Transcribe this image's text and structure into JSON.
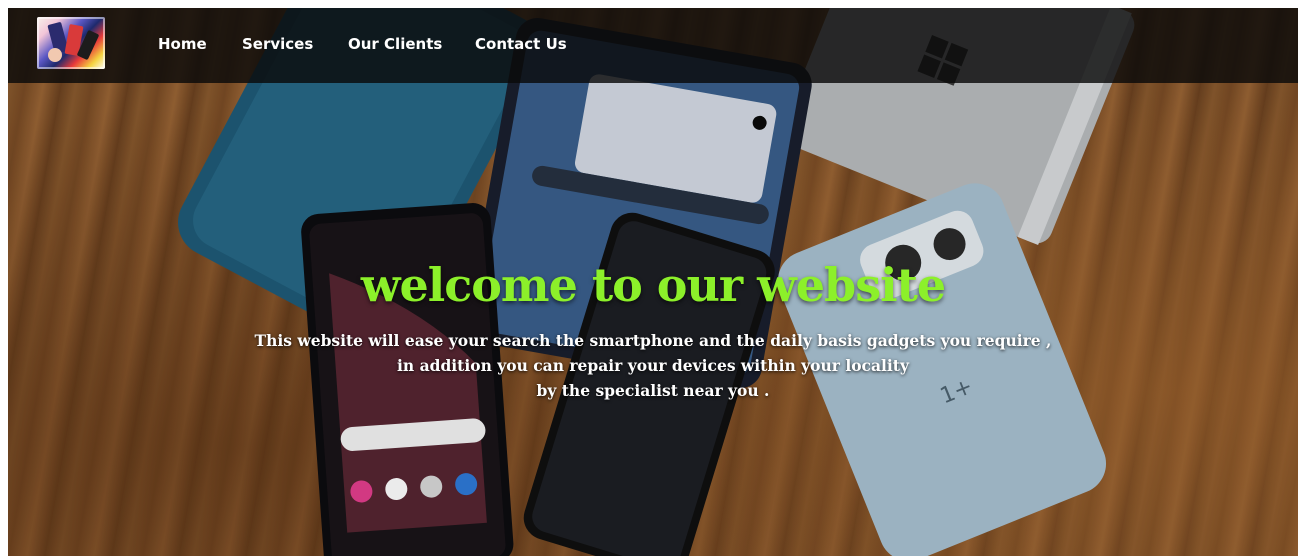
{
  "nav": {
    "logo_icon": "colorful-phones-logo-icon",
    "items": [
      {
        "label": "Home"
      },
      {
        "label": "Services"
      },
      {
        "label": "Our Clients"
      },
      {
        "label": "Contact Us"
      }
    ]
  },
  "hero": {
    "background": "smartphones-on-wooden-table-photo",
    "headline": "welcome to our website",
    "description_lines": [
      "This website will ease your search the smartphone and the daily basis gadgets you require ,",
      "in addition you can repair your devices within your locality",
      "by the specialist near you ."
    ]
  },
  "colors": {
    "nav_background": "#0a0a0a",
    "headline": "#8cf02a",
    "text": "#ffffff"
  }
}
